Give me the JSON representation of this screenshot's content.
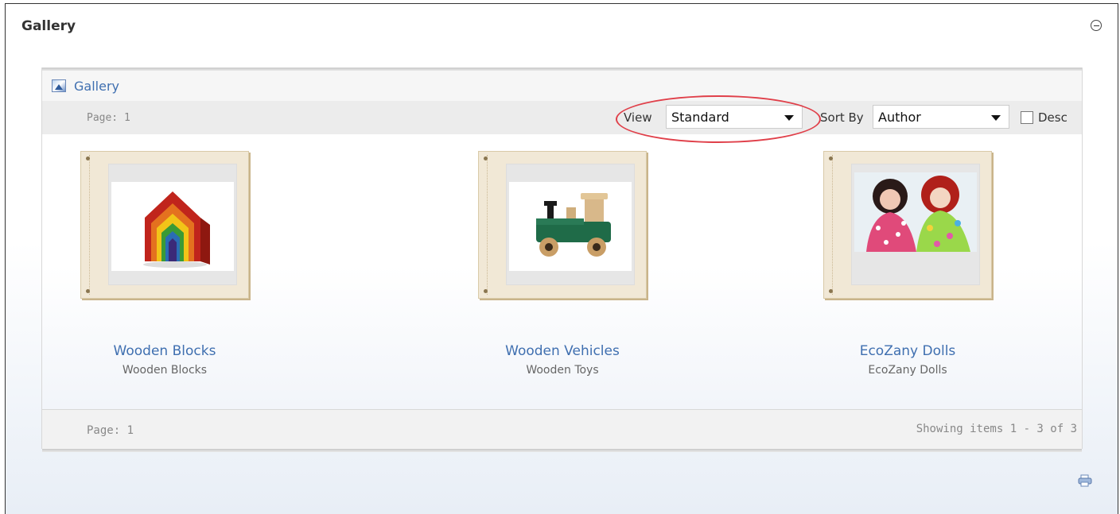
{
  "module": {
    "title": "Gallery"
  },
  "gallery": {
    "header_label": "Gallery",
    "toolbar": {
      "page_label": "Page: 1",
      "view_label": "View",
      "view_value": "Standard",
      "sort_label": "Sort By",
      "sort_value": "Author",
      "desc_label": "Desc",
      "desc_checked": false
    },
    "items": [
      {
        "title": "Wooden Blocks",
        "subtitle": "Wooden Blocks",
        "image": "rainbow-wooden-house-blocks"
      },
      {
        "title": "Wooden Vehicles",
        "subtitle": "Wooden Toys",
        "image": "wooden-toy-train"
      },
      {
        "title": "EcoZany Dolls",
        "subtitle": "EcoZany Dolls",
        "image": "rag-dolls"
      }
    ],
    "footer": {
      "page_label": "Page: 1",
      "showing": "Showing items 1 - 3 of 3"
    }
  },
  "colors": {
    "link": "#3f6fb0",
    "highlight": "#e0404a"
  },
  "icons": {
    "collapse": "minus-circle-icon",
    "gallery": "picture-icon",
    "print": "print-icon"
  }
}
